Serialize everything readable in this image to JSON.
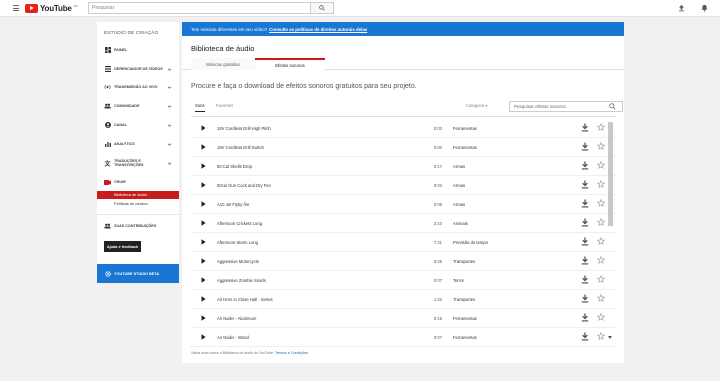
{
  "topbar": {
    "logo_text": "YouTube",
    "logo_suffix": "BR",
    "search_placeholder": "Pesquisar",
    "icons": [
      "menu-icon",
      "search-icon",
      "upload-icon",
      "bell-icon"
    ]
  },
  "sidebar": {
    "title": "ESTÚDIO DE CRIAÇÃO",
    "items": [
      {
        "label": "PAINEL",
        "icon": "dashboard-icon",
        "chevron": false
      },
      {
        "label": "GERENCIADOR DE VÍDEOS",
        "icon": "video-manager-icon",
        "chevron": true
      },
      {
        "label": "TRANSMISSÃO AO VIVO",
        "icon": "live-icon",
        "chevron": true
      },
      {
        "label": "COMUNIDADE",
        "icon": "community-icon",
        "chevron": true
      },
      {
        "label": "CANAL",
        "icon": "channel-icon",
        "chevron": true
      },
      {
        "label": "ANALYTICS",
        "icon": "analytics-icon",
        "chevron": true
      },
      {
        "label": "TRADUÇÕES E TRANSCRIÇÕES",
        "icon": "translate-icon",
        "chevron": true
      },
      {
        "label": "CRIAR",
        "icon": "create-icon",
        "chevron": false
      }
    ],
    "sub_items": [
      {
        "label": "Biblioteca de áudio",
        "active": true
      },
      {
        "label": "Políticas de música",
        "active": false
      }
    ],
    "contributions_label": "SUAS CONTRIBUIÇÕES",
    "help_button": "Ajuda e feedback",
    "beta_label": "YOUTUBE STUDIO BETA"
  },
  "banner": {
    "text": "Tem músicas diferentes em seu vídeo?",
    "link": "Consulte as políticas de direitos autorais delas"
  },
  "main": {
    "heading": "Biblioteca de áudio",
    "tabs": [
      {
        "label": "Músicas gratuitas",
        "active": false
      },
      {
        "label": "Efeitos sonoros",
        "active": true
      }
    ],
    "intro": "Procure e faça o download de efeitos sonoros gratuitos para seu projeto.",
    "filter_tabs": [
      {
        "label": "Sons",
        "active": true
      },
      {
        "label": "Favoritos",
        "active": false
      }
    ],
    "category_label": "Categoria",
    "library_search_placeholder": "Pesquisar efeitos sonoros",
    "rows": [
      {
        "title": "18V Cordless Drill High Pitch",
        "duration": "0:03",
        "genre": "Ferramentas"
      },
      {
        "title": "18V Cordless Drill Switch",
        "duration": "0:00",
        "genre": "Ferramentas"
      },
      {
        "title": "50 Cal Shells Drop",
        "duration": "0:17",
        "genre": "Armas"
      },
      {
        "title": "50cal Gun Cock and Dry Fire",
        "duration": "0:03",
        "genre": "Armas"
      },
      {
        "title": "A10 Jet Flyby fire",
        "duration": "0:06",
        "genre": "Armas"
      },
      {
        "title": "Afternoon Crickets Long",
        "duration": "2:10",
        "genre": "Animais"
      },
      {
        "title": "Afternoon Storm Long",
        "duration": "7:21",
        "genre": "Previsão do tempo"
      },
      {
        "title": "Aggressive Motorcycle",
        "duration": "0:25",
        "genre": "Transportes"
      },
      {
        "title": "Aggressive Zombie Snarls",
        "duration": "0:07",
        "genre": "Terror"
      },
      {
        "title": "Air Horn in Close Hall - Series",
        "duration": "1:23",
        "genre": "Transportes"
      },
      {
        "title": "Air Nailer - Aluminum",
        "duration": "0:15",
        "genre": "Ferramentas"
      },
      {
        "title": "Air Nailer - Wood",
        "duration": "0:07",
        "genre": "Ferramentas"
      }
    ],
    "footer_text": "Saiba mais sobre a Biblioteca de áudio do YouTube.",
    "footer_link": "Termos e Condições"
  }
}
